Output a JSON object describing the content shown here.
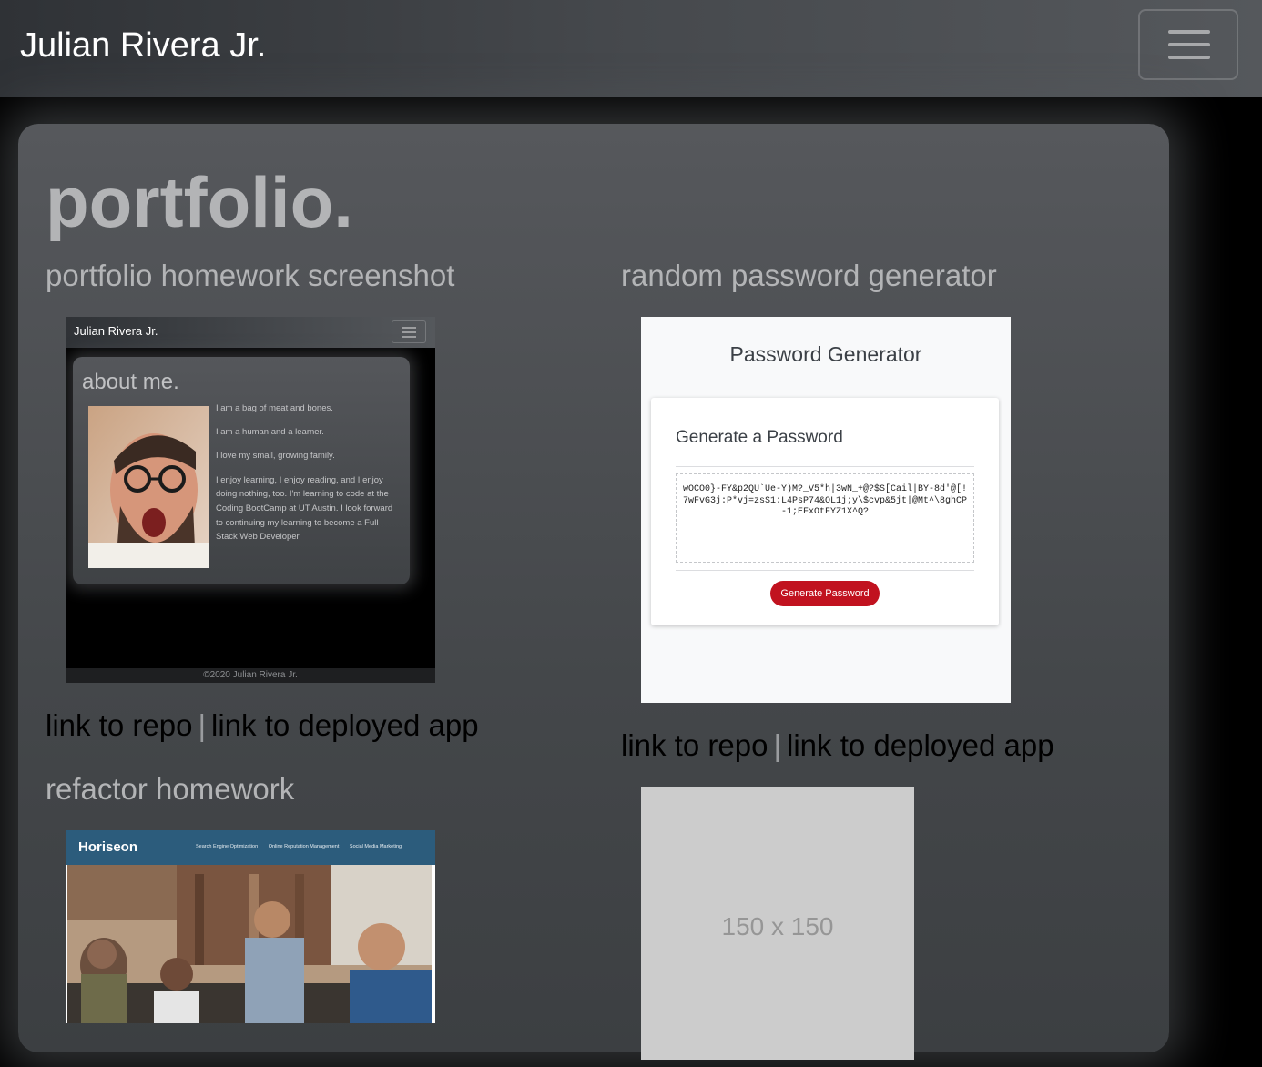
{
  "navbar": {
    "brand": "Julian Rivera Jr.",
    "toggle_icon": "hamburger-icon"
  },
  "page": {
    "title": "portfolio."
  },
  "projects": [
    {
      "title": "portfolio homework screenshot",
      "repo_link": "link to repo",
      "separator": "|",
      "deploy_link": "link to deployed app",
      "screenshot": {
        "brand": "Julian Rivera Jr.",
        "heading": "about me.",
        "lines": [
          "I am a bag of meat and bones.",
          "I am a human and a learner.",
          "I love my small, growing family.",
          "I enjoy learning, I enjoy reading, and I enjoy doing nothing, too. I'm learning to code at the Coding BootCamp at UT Austin. I look forward to continuing my learning to become a Full Stack Web Developer."
        ],
        "footer": "©2020 Julian Rivera Jr."
      }
    },
    {
      "title": "random password generator",
      "repo_link": "link to repo",
      "separator": "|",
      "deploy_link": "link to deployed app",
      "screenshot": {
        "title": "Password Generator",
        "heading": "Generate a Password",
        "password": "wOCO0}-FY&p2QU`Ue-Y)M?_V5*h|3wN_+@?$S[Cail|BY-8d'@[!7wFvG3j:P*vj=zsS1:L4PsP74&OL1j;y\\$cvp&5jt|@Mt^\\8ghCP-1;EFxOtFYZ1X^Q?",
        "button": "Generate Password"
      }
    },
    {
      "title": "refactor homework",
      "screenshot": {
        "brand": "Horiseon",
        "menu": [
          "Search Engine Optimization",
          "Online Reputation Management",
          "Social Media Marketing"
        ]
      }
    }
  ],
  "placeholder": {
    "label": "150 x 150"
  },
  "colors": {
    "navbar": "#46494d",
    "card": "#4d5053",
    "accent_button": "#c1121f",
    "horiseon_nav": "#2c5c7c"
  }
}
